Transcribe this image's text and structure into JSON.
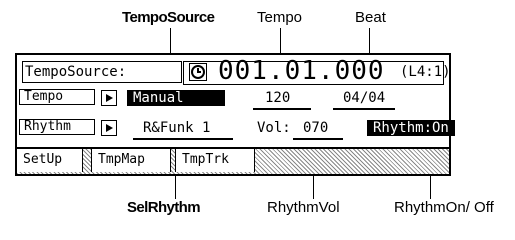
{
  "callouts": {
    "tempo_source": "TempoSource",
    "tempo": "Tempo",
    "beat": "Beat",
    "sel_rhythm": "SelRhythm",
    "rhythm_vol": "RhythmVol",
    "rhythm_on_off": "RhythmOn/ Off"
  },
  "screen": {
    "tempo_source_label": "TempoSource:",
    "counter": "001.01.000",
    "ratio": "(L4:1)",
    "tempo_row": {
      "label": "Tempo",
      "source_value": "Manual",
      "tempo_value": "120",
      "beat_value": "04/04"
    },
    "rhythm_row": {
      "label": "Rhythm",
      "pattern": "R&Funk 1",
      "vol_label": "Vol:",
      "vol_value": "070",
      "status": "Rhythm:On"
    },
    "tabs": [
      "SetUp",
      "TmpMap",
      "TmpTrk"
    ]
  }
}
